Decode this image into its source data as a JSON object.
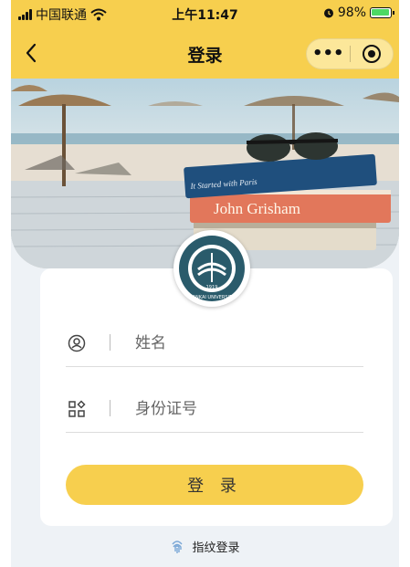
{
  "status_bar": {
    "carrier": "中国联通",
    "time": "上午11:47",
    "battery": "98%",
    "battery_level": 0.98
  },
  "navbar": {
    "title": "登录",
    "more": "•••"
  },
  "logo": {
    "text": "NANKAI UNIVERSITY",
    "year": "1919"
  },
  "banner": {
    "book_top": "It Started with Paris",
    "book_middle": "John Grisham"
  },
  "form": {
    "name_placeholder": "姓名",
    "id_placeholder": "身份证号",
    "login_label": "登 录"
  },
  "fingerprint": {
    "label": "指纹登录"
  },
  "colors": {
    "accent": "#f7cf4e",
    "background": "#eef2f6"
  }
}
